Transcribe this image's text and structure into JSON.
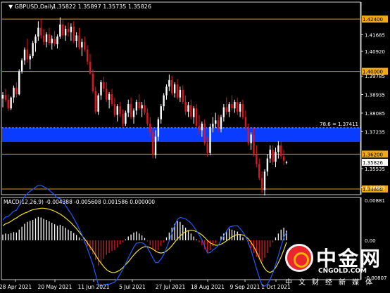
{
  "chart_data": [
    {
      "type": "candlestick",
      "title": "GBPUSD,Daily",
      "ohlc_readout": "1.35822 1.35897 1.35735 1.35826",
      "ylim": [
        1.3434,
        1.4318
      ],
      "grid": false,
      "x_tick_labels": [
        "28 Apr 2021",
        "20 May 2021",
        "11 Jun 2021",
        "5 Jul 2021",
        "27 Jul 2021",
        "18 Aug 2021",
        "9 Sep 2021",
        "1 Oct 2021"
      ],
      "y_tick_labels": [
        {
          "value": 1.424,
          "text": "1.42400",
          "highlight": true
        },
        {
          "value": 1.41685,
          "text": "1.41685",
          "highlight": false
        },
        {
          "value": 1.4092,
          "text": "1.40920",
          "highlight": false
        },
        {
          "value": 1.4,
          "text": "1.40000",
          "highlight": true
        },
        {
          "value": 1.39785,
          "text": "1.39785",
          "highlight": false
        },
        {
          "value": 1.38935,
          "text": "1.38935",
          "highlight": false
        },
        {
          "value": 1.38085,
          "text": "1.38085",
          "highlight": false
        },
        {
          "value": 1.37235,
          "text": "1.37235",
          "highlight": false
        },
        {
          "value": 1.362,
          "text": "1.36200",
          "highlight": true
        },
        {
          "value": 1.35535,
          "text": "1.35535",
          "highlight": false
        },
        {
          "value": 1.35826,
          "text": "1.35826",
          "highlight": "current"
        },
        {
          "value": 1.346,
          "text": "1.34600",
          "highlight": true
        },
        {
          "value": 1.34685,
          "text": "1.34685",
          "highlight": false
        }
      ],
      "horizontal_lines": [
        {
          "value": 1.424,
          "color": "#d4a017"
        },
        {
          "value": 1.4,
          "color": "#d4a017"
        },
        {
          "value": 1.362,
          "color": "#d4a017"
        },
        {
          "value": 1.346,
          "color": "#d4a017"
        }
      ],
      "zone": {
        "from": 1.3676,
        "to": 1.3741,
        "color": "#0a3cff",
        "label": "78.6 = 1.37411"
      },
      "up_color": "#ffffff",
      "down_color": "#e0141e",
      "candles": [
        {
          "o": 1.3875,
          "h": 1.3905,
          "l": 1.3835,
          "c": 1.3892
        },
        {
          "o": 1.3892,
          "h": 1.392,
          "l": 1.386,
          "c": 1.387
        },
        {
          "o": 1.387,
          "h": 1.3895,
          "l": 1.3818,
          "c": 1.383
        },
        {
          "o": 1.383,
          "h": 1.3885,
          "l": 1.3822,
          "c": 1.388
        },
        {
          "o": 1.388,
          "h": 1.3935,
          "l": 1.3855,
          "c": 1.3925
        },
        {
          "o": 1.3925,
          "h": 1.395,
          "l": 1.388,
          "c": 1.3895
        },
        {
          "o": 1.3895,
          "h": 1.401,
          "l": 1.389,
          "c": 1.4
        },
        {
          "o": 1.4,
          "h": 1.406,
          "l": 1.399,
          "c": 1.405
        },
        {
          "o": 1.405,
          "h": 1.411,
          "l": 1.403,
          "c": 1.41
        },
        {
          "o": 1.41,
          "h": 1.415,
          "l": 1.404,
          "c": 1.4055
        },
        {
          "o": 1.4055,
          "h": 1.408,
          "l": 1.401,
          "c": 1.407
        },
        {
          "o": 1.407,
          "h": 1.414,
          "l": 1.406,
          "c": 1.413
        },
        {
          "o": 1.413,
          "h": 1.417,
          "l": 1.409,
          "c": 1.416
        },
        {
          "o": 1.416,
          "h": 1.423,
          "l": 1.414,
          "c": 1.42
        },
        {
          "o": 1.42,
          "h": 1.424,
          "l": 1.415,
          "c": 1.4165
        },
        {
          "o": 1.4165,
          "h": 1.4195,
          "l": 1.412,
          "c": 1.4135
        },
        {
          "o": 1.4135,
          "h": 1.418,
          "l": 1.411,
          "c": 1.417
        },
        {
          "o": 1.417,
          "h": 1.42,
          "l": 1.412,
          "c": 1.413
        },
        {
          "o": 1.413,
          "h": 1.4165,
          "l": 1.41,
          "c": 1.415
        },
        {
          "o": 1.415,
          "h": 1.4185,
          "l": 1.4115,
          "c": 1.4125
        },
        {
          "o": 1.4125,
          "h": 1.417,
          "l": 1.4105,
          "c": 1.416
        },
        {
          "o": 1.416,
          "h": 1.4248,
          "l": 1.415,
          "c": 1.4215
        },
        {
          "o": 1.4215,
          "h": 1.4235,
          "l": 1.415,
          "c": 1.4165
        },
        {
          "o": 1.4165,
          "h": 1.421,
          "l": 1.414,
          "c": 1.4195
        },
        {
          "o": 1.4195,
          "h": 1.4225,
          "l": 1.416,
          "c": 1.418
        },
        {
          "o": 1.418,
          "h": 1.422,
          "l": 1.414,
          "c": 1.4205
        },
        {
          "o": 1.4205,
          "h": 1.423,
          "l": 1.413,
          "c": 1.414
        },
        {
          "o": 1.414,
          "h": 1.418,
          "l": 1.411,
          "c": 1.4165
        },
        {
          "o": 1.4165,
          "h": 1.42,
          "l": 1.41,
          "c": 1.411
        },
        {
          "o": 1.411,
          "h": 1.415,
          "l": 1.407,
          "c": 1.4135
        },
        {
          "o": 1.4135,
          "h": 1.416,
          "l": 1.409,
          "c": 1.41
        },
        {
          "o": 1.41,
          "h": 1.412,
          "l": 1.403,
          "c": 1.4045
        },
        {
          "o": 1.4045,
          "h": 1.408,
          "l": 1.3985,
          "c": 1.399
        },
        {
          "o": 1.399,
          "h": 1.401,
          "l": 1.39,
          "c": 1.391
        },
        {
          "o": 1.391,
          "h": 1.393,
          "l": 1.3805,
          "c": 1.3815
        },
        {
          "o": 1.3815,
          "h": 1.39,
          "l": 1.38,
          "c": 1.389
        },
        {
          "o": 1.389,
          "h": 1.396,
          "l": 1.387,
          "c": 1.395
        },
        {
          "o": 1.395,
          "h": 1.3975,
          "l": 1.3905,
          "c": 1.392
        },
        {
          "o": 1.392,
          "h": 1.395,
          "l": 1.386,
          "c": 1.387
        },
        {
          "o": 1.387,
          "h": 1.3905,
          "l": 1.383,
          "c": 1.3895
        },
        {
          "o": 1.3895,
          "h": 1.392,
          "l": 1.384,
          "c": 1.385
        },
        {
          "o": 1.385,
          "h": 1.388,
          "l": 1.379,
          "c": 1.38
        },
        {
          "o": 1.38,
          "h": 1.385,
          "l": 1.377,
          "c": 1.384
        },
        {
          "o": 1.384,
          "h": 1.386,
          "l": 1.379,
          "c": 1.3805
        },
        {
          "o": 1.3805,
          "h": 1.3825,
          "l": 1.3745,
          "c": 1.376
        },
        {
          "o": 1.376,
          "h": 1.382,
          "l": 1.375,
          "c": 1.381
        },
        {
          "o": 1.381,
          "h": 1.387,
          "l": 1.379,
          "c": 1.385
        },
        {
          "o": 1.385,
          "h": 1.388,
          "l": 1.378,
          "c": 1.379
        },
        {
          "o": 1.379,
          "h": 1.383,
          "l": 1.376,
          "c": 1.382
        },
        {
          "o": 1.382,
          "h": 1.387,
          "l": 1.38,
          "c": 1.386
        },
        {
          "o": 1.386,
          "h": 1.3895,
          "l": 1.382,
          "c": 1.383
        },
        {
          "o": 1.383,
          "h": 1.386,
          "l": 1.379,
          "c": 1.3845
        },
        {
          "o": 1.3845,
          "h": 1.387,
          "l": 1.38,
          "c": 1.381
        },
        {
          "o": 1.381,
          "h": 1.383,
          "l": 1.375,
          "c": 1.376
        },
        {
          "o": 1.376,
          "h": 1.379,
          "l": 1.37,
          "c": 1.372
        },
        {
          "o": 1.372,
          "h": 1.374,
          "l": 1.36,
          "c": 1.3615
        },
        {
          "o": 1.3615,
          "h": 1.373,
          "l": 1.36,
          "c": 1.37
        },
        {
          "o": 1.37,
          "h": 1.379,
          "l": 1.368,
          "c": 1.378
        },
        {
          "o": 1.378,
          "h": 1.385,
          "l": 1.376,
          "c": 1.384
        },
        {
          "o": 1.384,
          "h": 1.39,
          "l": 1.382,
          "c": 1.389
        },
        {
          "o": 1.389,
          "h": 1.394,
          "l": 1.387,
          "c": 1.393
        },
        {
          "o": 1.393,
          "h": 1.3985,
          "l": 1.391,
          "c": 1.396
        },
        {
          "o": 1.396,
          "h": 1.398,
          "l": 1.389,
          "c": 1.39
        },
        {
          "o": 1.39,
          "h": 1.395,
          "l": 1.388,
          "c": 1.394
        },
        {
          "o": 1.394,
          "h": 1.3965,
          "l": 1.387,
          "c": 1.388
        },
        {
          "o": 1.388,
          "h": 1.393,
          "l": 1.386,
          "c": 1.3915
        },
        {
          "o": 1.3915,
          "h": 1.3935,
          "l": 1.385,
          "c": 1.386
        },
        {
          "o": 1.386,
          "h": 1.389,
          "l": 1.38,
          "c": 1.3815
        },
        {
          "o": 1.3815,
          "h": 1.386,
          "l": 1.379,
          "c": 1.3845
        },
        {
          "o": 1.3845,
          "h": 1.387,
          "l": 1.378,
          "c": 1.379
        },
        {
          "o": 1.379,
          "h": 1.384,
          "l": 1.376,
          "c": 1.383
        },
        {
          "o": 1.383,
          "h": 1.385,
          "l": 1.374,
          "c": 1.375
        },
        {
          "o": 1.375,
          "h": 1.38,
          "l": 1.371,
          "c": 1.373
        },
        {
          "o": 1.373,
          "h": 1.377,
          "l": 1.37,
          "c": 1.376
        },
        {
          "o": 1.376,
          "h": 1.378,
          "l": 1.366,
          "c": 1.367
        },
        {
          "o": 1.367,
          "h": 1.37,
          "l": 1.361,
          "c": 1.3625
        },
        {
          "o": 1.3625,
          "h": 1.376,
          "l": 1.3615,
          "c": 1.3745
        },
        {
          "o": 1.3745,
          "h": 1.379,
          "l": 1.372,
          "c": 1.376
        },
        {
          "o": 1.376,
          "h": 1.381,
          "l": 1.374,
          "c": 1.3775
        },
        {
          "o": 1.3775,
          "h": 1.38,
          "l": 1.372,
          "c": 1.3735
        },
        {
          "o": 1.3735,
          "h": 1.38,
          "l": 1.372,
          "c": 1.379
        },
        {
          "o": 1.379,
          "h": 1.385,
          "l": 1.377,
          "c": 1.3835
        },
        {
          "o": 1.3835,
          "h": 1.388,
          "l": 1.38,
          "c": 1.3815
        },
        {
          "o": 1.3815,
          "h": 1.386,
          "l": 1.379,
          "c": 1.385
        },
        {
          "o": 1.385,
          "h": 1.389,
          "l": 1.382,
          "c": 1.383
        },
        {
          "o": 1.383,
          "h": 1.387,
          "l": 1.381,
          "c": 1.386
        },
        {
          "o": 1.386,
          "h": 1.388,
          "l": 1.38,
          "c": 1.3815
        },
        {
          "o": 1.3815,
          "h": 1.386,
          "l": 1.379,
          "c": 1.385
        },
        {
          "o": 1.385,
          "h": 1.387,
          "l": 1.378,
          "c": 1.379
        },
        {
          "o": 1.379,
          "h": 1.382,
          "l": 1.373,
          "c": 1.3745
        },
        {
          "o": 1.3745,
          "h": 1.376,
          "l": 1.366,
          "c": 1.367
        },
        {
          "o": 1.367,
          "h": 1.372,
          "l": 1.364,
          "c": 1.371
        },
        {
          "o": 1.371,
          "h": 1.374,
          "l": 1.361,
          "c": 1.362
        },
        {
          "o": 1.362,
          "h": 1.366,
          "l": 1.356,
          "c": 1.3575
        },
        {
          "o": 1.3575,
          "h": 1.36,
          "l": 1.35,
          "c": 1.351
        },
        {
          "o": 1.351,
          "h": 1.354,
          "l": 1.344,
          "c": 1.3455
        },
        {
          "o": 1.3455,
          "h": 1.355,
          "l": 1.343,
          "c": 1.354
        },
        {
          "o": 1.354,
          "h": 1.362,
          "l": 1.352,
          "c": 1.36
        },
        {
          "o": 1.36,
          "h": 1.366,
          "l": 1.358,
          "c": 1.364
        },
        {
          "o": 1.364,
          "h": 1.366,
          "l": 1.357,
          "c": 1.3585
        },
        {
          "o": 1.3585,
          "h": 1.365,
          "l": 1.356,
          "c": 1.363
        },
        {
          "o": 1.363,
          "h": 1.368,
          "l": 1.36,
          "c": 1.366
        },
        {
          "o": 1.366,
          "h": 1.368,
          "l": 1.36,
          "c": 1.361
        },
        {
          "o": 1.361,
          "h": 1.364,
          "l": 1.357,
          "c": 1.359
        },
        {
          "o": 1.35822,
          "h": 1.35897,
          "l": 1.35735,
          "c": 1.35826
        }
      ]
    },
    {
      "type": "bar+line",
      "title": "MACD(12,26,9) -0.004388 -0.005608 0.001586 0.000000",
      "ylim": [
        -0.00807,
        0.00881
      ],
      "y_tick_labels": [
        {
          "value": 0.00881,
          "text": "0.00881"
        },
        {
          "value": 0.0,
          "text": "0.00"
        },
        {
          "value": -0.00807,
          "text": "-0.00807"
        }
      ],
      "histogram": [
        0.0012,
        0.0014,
        0.0013,
        0.0015,
        0.0017,
        0.0016,
        0.0022,
        0.0028,
        0.0034,
        0.0038,
        0.004,
        0.0042,
        0.0045,
        0.0048,
        0.0047,
        0.0044,
        0.0042,
        0.0039,
        0.0036,
        0.0033,
        0.003,
        0.0032,
        0.0029,
        0.0026,
        0.0022,
        0.0019,
        0.0015,
        0.0011,
        0.0006,
        0.0002,
        -0.0006,
        -0.0012,
        -0.002,
        -0.0028,
        -0.004,
        -0.0052,
        -0.0046,
        -0.0038,
        -0.003,
        -0.0026,
        -0.0022,
        -0.002,
        -0.0015,
        -0.0008,
        -0.0004,
        0.0002,
        0.0008,
        0.0012,
        0.0016,
        0.0018,
        0.0014,
        0.001,
        0.0005,
        -0.0002,
        -0.001,
        -0.0018,
        -0.0024,
        -0.002,
        -0.0012,
        -0.0004,
        0.0006,
        0.0016,
        0.0026,
        0.0034,
        0.004,
        0.0038,
        0.0032,
        0.0026,
        0.002,
        0.0014,
        0.0008,
        0.0002,
        -0.0004,
        -0.001,
        -0.0018,
        -0.0026,
        -0.002,
        -0.0012,
        -0.0006,
        0.0,
        0.0008,
        0.0014,
        0.002,
        0.0024,
        0.0022,
        0.002,
        0.0018,
        0.0012,
        0.0006,
        0.0,
        -0.0008,
        -0.0016,
        -0.0026,
        -0.0034,
        -0.004,
        -0.0044,
        -0.0036,
        -0.0026,
        -0.0014,
        -0.0004,
        0.0006,
        0.0014,
        0.0022,
        0.0026,
        0.002
      ],
      "signal": [
        0.003,
        0.0034,
        0.0036,
        0.0039,
        0.0043,
        0.0046,
        0.005,
        0.0053,
        0.0056,
        0.0058,
        0.0061,
        0.0063,
        0.0064,
        0.0065,
        0.0066,
        0.0066,
        0.0065,
        0.0064,
        0.0062,
        0.006,
        0.0057,
        0.0054,
        0.005,
        0.0046,
        0.0041,
        0.0036,
        0.003,
        0.0024,
        0.0017,
        0.001,
        0.0003,
        -0.0005,
        -0.0013,
        -0.0021,
        -0.003,
        -0.0039,
        -0.0047,
        -0.0054,
        -0.006,
        -0.0064,
        -0.0066,
        -0.0066,
        -0.0064,
        -0.0061,
        -0.0056,
        -0.005,
        -0.0044,
        -0.0037,
        -0.003,
        -0.0024,
        -0.0019,
        -0.0015,
        -0.0013,
        -0.0013,
        -0.0015,
        -0.0018,
        -0.0022,
        -0.0025,
        -0.0026,
        -0.0025,
        -0.0022,
        -0.0017,
        -0.0011,
        -0.0004,
        0.0003,
        0.0009,
        0.0014,
        0.0018,
        0.002,
        0.0021,
        0.002,
        0.0018,
        0.0015,
        0.0011,
        0.0006,
        0.0,
        -0.0005,
        -0.0008,
        -0.001,
        -0.001,
        -0.0008,
        -0.0005,
        -0.0001,
        0.0003,
        0.0007,
        0.001,
        0.0012,
        0.0012,
        0.0011,
        0.0008,
        0.0003,
        -0.0004,
        -0.0013,
        -0.0024,
        -0.0036,
        -0.0048,
        -0.0058,
        -0.0064,
        -0.0066,
        -0.0063,
        -0.0056,
        -0.0046,
        -0.0034,
        -0.002,
        -0.0004
      ],
      "macd_line_color": "#1e5bff",
      "signal_line_color": "#f0e020"
    }
  ],
  "watermark": {
    "main": "中金网",
    "url": "CNGOLD.COM",
    "sub": "中文财经新媒体"
  }
}
